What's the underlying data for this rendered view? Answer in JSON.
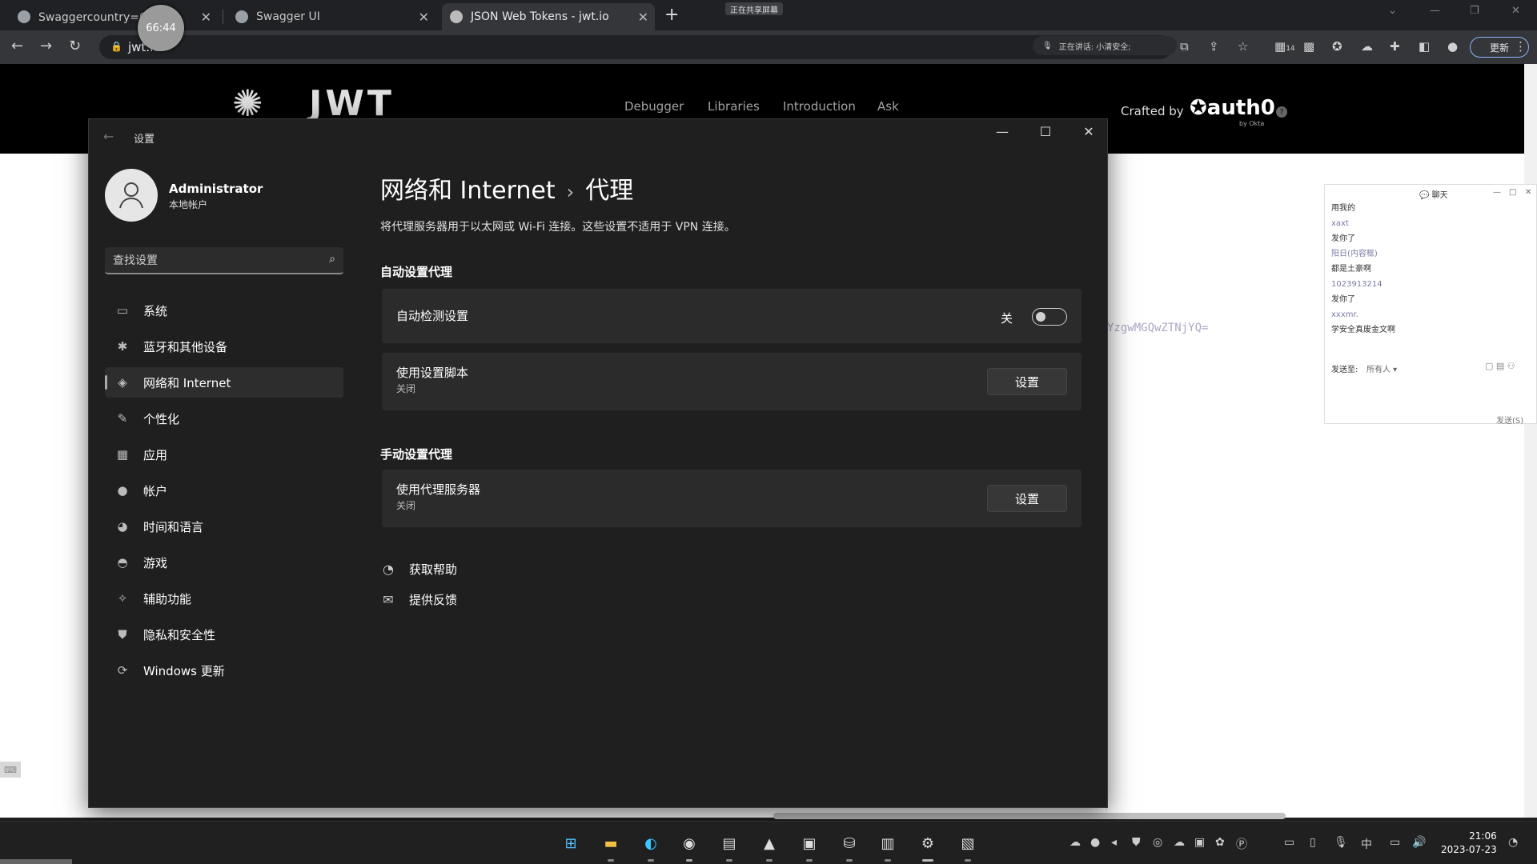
{
  "browser": {
    "tabs": [
      {
        "title": "Swaggercountry=CN天计",
        "active": false
      },
      {
        "title": "Swagger UI",
        "active": false
      },
      {
        "title": "JSON Web Tokens - jwt.io",
        "active": true
      }
    ],
    "timer": "66:44",
    "sharing_badge": "正在共享屏幕",
    "url": "jwt.io",
    "voice_status": "正在讲话: 小清安全;",
    "badge_count": "14",
    "update_label": "更新"
  },
  "webpage": {
    "logo": "JWT",
    "nav": [
      "Debugger",
      "Libraries",
      "Introduction",
      "Ask"
    ],
    "crafted_by": "Crafted by",
    "brand": "auth0",
    "brand_sub": "by Okta",
    "token_fragment": "YzgwMGQwZTNjYQ="
  },
  "chat": {
    "title": "聊天",
    "messages": [
      {
        "text": "用我的",
        "meta": false
      },
      {
        "text": "xaxt",
        "meta": true
      },
      {
        "text": "发你了",
        "meta": false
      },
      {
        "text": "阳日(内容框)",
        "meta": true
      },
      {
        "text": "都是土豪啊",
        "meta": false
      },
      {
        "text": "1023913214",
        "meta": true
      },
      {
        "text": "发你了",
        "meta": false
      },
      {
        "text": "xxxmr.",
        "meta": true
      },
      {
        "text": "学安全真废金文啊",
        "meta": false
      }
    ],
    "send_to_label": "发送至:",
    "send_to_value": "所有人",
    "send_button": "发送(S)"
  },
  "settings": {
    "window_title": "设置",
    "user": {
      "name": "Administrator",
      "type": "本地帐户"
    },
    "search_placeholder": "查找设置",
    "nav": [
      {
        "label": "系统",
        "icon": "display-icon"
      },
      {
        "label": "蓝牙和其他设备",
        "icon": "bluetooth-icon"
      },
      {
        "label": "网络和 Internet",
        "icon": "wifi-icon",
        "active": true
      },
      {
        "label": "个性化",
        "icon": "brush-icon"
      },
      {
        "label": "应用",
        "icon": "apps-icon"
      },
      {
        "label": "帐户",
        "icon": "person-icon"
      },
      {
        "label": "时间和语言",
        "icon": "globe-clock-icon"
      },
      {
        "label": "游戏",
        "icon": "gamepad-icon"
      },
      {
        "label": "辅助功能",
        "icon": "accessibility-icon"
      },
      {
        "label": "隐私和安全性",
        "icon": "shield-icon"
      },
      {
        "label": "Windows 更新",
        "icon": "update-icon"
      }
    ],
    "breadcrumb": {
      "parent": "网络和 Internet",
      "separator": "›",
      "current": "代理"
    },
    "description": "将代理服务器用于以太网或 Wi-Fi 连接。这些设置不适用于 VPN 连接。",
    "auto_section": {
      "heading": "自动设置代理",
      "detect": {
        "label": "自动检测设置",
        "state": "关",
        "on": false
      },
      "script": {
        "label": "使用设置脚本",
        "status": "关闭",
        "button": "设置"
      }
    },
    "manual_section": {
      "heading": "手动设置代理",
      "proxy": {
        "label": "使用代理服务器",
        "status": "关闭",
        "button": "设置"
      }
    },
    "links": {
      "help": "获取帮助",
      "feedback": "提供反馈"
    }
  },
  "taskbar": {
    "time": "21:06",
    "date": "2023-07-23",
    "ime": "中"
  }
}
